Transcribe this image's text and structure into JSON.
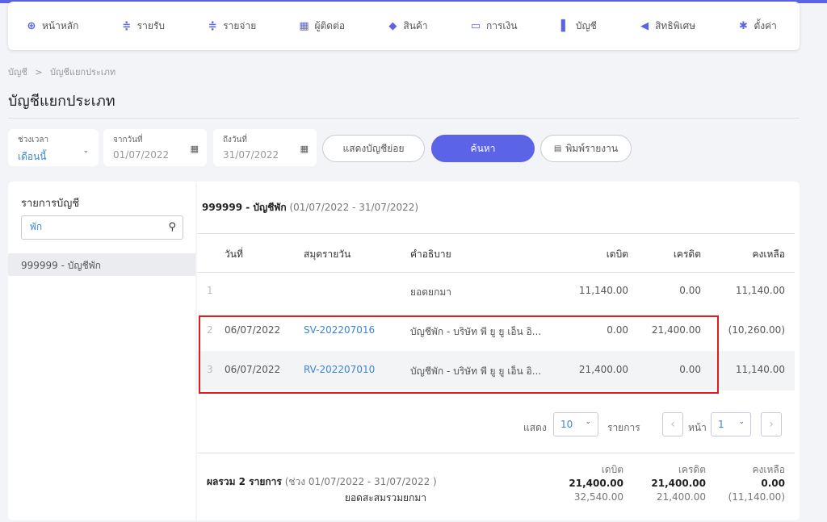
{
  "nav": [
    {
      "icon": "home-icon",
      "glyph": "⊕",
      "label": "หน้าหลัก"
    },
    {
      "icon": "income-icon",
      "glyph": "≑",
      "label": "รายรับ"
    },
    {
      "icon": "expense-icon",
      "glyph": "≑",
      "label": "รายจ่าย"
    },
    {
      "icon": "contacts-icon",
      "glyph": "▦",
      "label": "ผู้ติดต่อ"
    },
    {
      "icon": "product-icon",
      "glyph": "◆",
      "label": "สินค้า"
    },
    {
      "icon": "finance-icon",
      "glyph": "▭",
      "label": "การเงิน"
    },
    {
      "icon": "accounting-icon",
      "glyph": "▌",
      "label": "บัญชี"
    },
    {
      "icon": "privilege-icon",
      "glyph": "◀",
      "label": "สิทธิพิเศษ"
    },
    {
      "icon": "settings-icon",
      "glyph": "✱",
      "label": "ตั้งค่า"
    }
  ],
  "breadcrumb": {
    "root": "บัญชี",
    "sep": ">",
    "current": "บัญชีแยกประเภท"
  },
  "page_title": "บัญชีแยกประเภท",
  "filters": {
    "period_label": "ช่วงเวลา",
    "period_value": "เดือนนี้",
    "from_label": "จากวันที่",
    "from_value": "01/07/2022",
    "to_label": "ถึงวันที่",
    "to_value": "31/07/2022",
    "show_sub_button": "แสดงบัญชีย่อย",
    "search_button": "ค้นหา",
    "print_button": "พิมพ์รายงาน"
  },
  "left": {
    "title": "รายการบัญชี",
    "search_value": "พัก",
    "items": [
      "999999 - บัญชีพัก"
    ]
  },
  "account": {
    "code_name": "999999 - บัญชีพัก",
    "range": "(01/07/2022 - 31/07/2022)"
  },
  "table": {
    "headers": {
      "date": "วันที่",
      "journal": "สมุดรายวัน",
      "desc": "คำอธิบาย",
      "debit": "เดบิต",
      "credit": "เครดิต",
      "balance": "คงเหลือ"
    },
    "rows": [
      {
        "no": "1",
        "date": "",
        "journal": "",
        "desc": "ยอดยกมา",
        "debit": "11,140.00",
        "credit": "0.00",
        "balance": "11,140.00"
      },
      {
        "no": "2",
        "date": "06/07/2022",
        "journal": "SV-202207016",
        "desc": "บัญชีพัก - บริษัท พี ยู ยู เอ็น อิ...",
        "debit": "0.00",
        "credit": "21,400.00",
        "balance": "(10,260.00)"
      },
      {
        "no": "3",
        "date": "06/07/2022",
        "journal": "RV-202207010",
        "desc": "บัญชีพัก - บริษัท พี ยู ยู เอ็น อิ...",
        "debit": "21,400.00",
        "credit": "0.00",
        "balance": "11,140.00"
      }
    ]
  },
  "pager": {
    "show_label": "แสดง",
    "page_size": "10",
    "items_label": "รายการ",
    "page_label": "หน้า",
    "page": "1"
  },
  "summary": {
    "total_label": "ผลรวม 2 รายการ",
    "range": "(ช่วง 01/07/2022 - 31/07/2022 )",
    "carry_label": "ยอดสะสมรวมยกมา",
    "debit_label": "เดบิต",
    "credit_label": "เครดิต",
    "balance_label": "คงเหลือ",
    "debit_total": "21,400.00",
    "credit_total": "21,400.00",
    "balance_total": "0.00",
    "debit_carry": "32,540.00",
    "credit_carry": "21,400.00",
    "balance_carry": "(11,140.00)"
  },
  "colors": {
    "accent": "#5b63e6",
    "link": "#3b86d8",
    "highlight": "#e21b1b"
  }
}
